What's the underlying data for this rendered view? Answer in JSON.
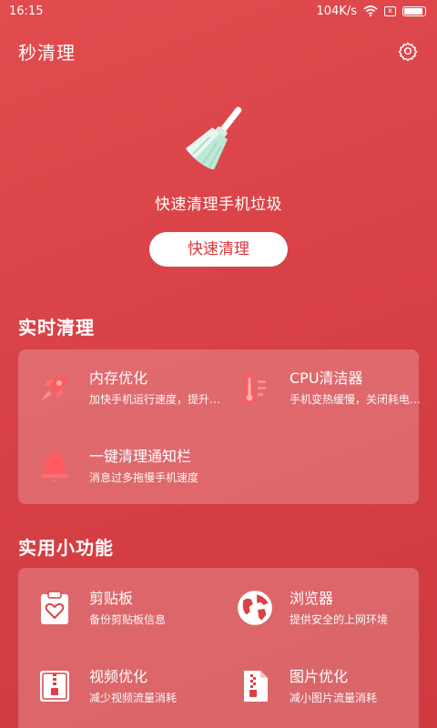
{
  "status_bar": {
    "time": "16:15",
    "speed": "104K/s",
    "sim_label": "x"
  },
  "header": {
    "title": "秒清理"
  },
  "hero": {
    "title": "快速清理手机垃圾",
    "button_label": "快速清理"
  },
  "realtime": {
    "title": "实时清理",
    "items": [
      {
        "name": "内存优化",
        "desc": "加快手机运行速度，提升流畅度",
        "icon": "rocket-icon"
      },
      {
        "name": "CPU清洁器",
        "desc": "手机变热缓慢，关闭耗电应用",
        "icon": "thermometer-icon"
      },
      {
        "name": "一键清理通知栏",
        "desc": "消息过多拖慢手机速度",
        "icon": "bell-icon"
      }
    ]
  },
  "tools": {
    "title": "实用小功能",
    "items": [
      {
        "name": "剪贴板",
        "desc": "备份剪贴板信息",
        "icon": "clipboard-heart-icon"
      },
      {
        "name": "浏览器",
        "desc": "提供安全的上网环境",
        "icon": "globe-icon"
      },
      {
        "name": "视频优化",
        "desc": "减少视频流量消耗",
        "icon": "zip-file-icon"
      },
      {
        "name": "图片优化",
        "desc": "减小图片流量消耗",
        "icon": "image-file-icon"
      }
    ]
  },
  "colors": {
    "background": "#d94347",
    "accent_button_text": "#d6383c",
    "realtime_icon": "#ff5a5f"
  }
}
